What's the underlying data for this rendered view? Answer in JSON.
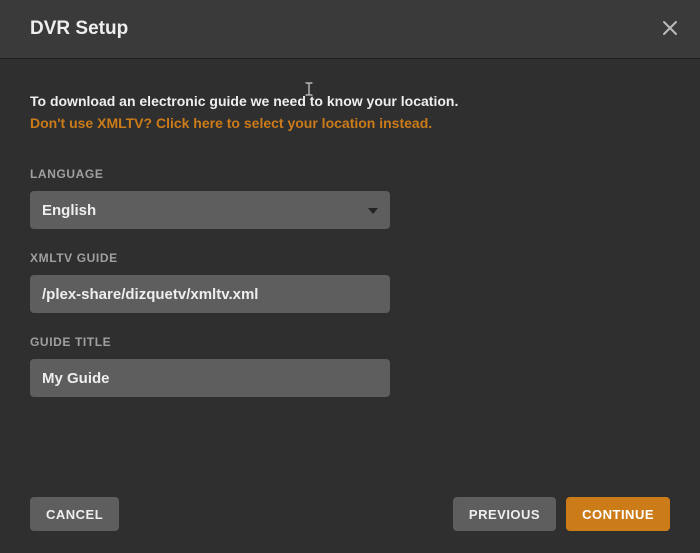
{
  "header": {
    "title": "DVR Setup"
  },
  "intro": {
    "text": "To download an electronic guide we need to know your location.",
    "link": "Don't use XMLTV? Click here to select your location instead."
  },
  "fields": {
    "language": {
      "label": "LANGUAGE",
      "value": "English"
    },
    "xmltv_guide": {
      "label": "XMLTV GUIDE",
      "value": "/plex-share/dizquetv/xmltv.xml"
    },
    "guide_title": {
      "label": "GUIDE TITLE",
      "value": "My Guide"
    }
  },
  "buttons": {
    "cancel": "CANCEL",
    "previous": "PREVIOUS",
    "continue": "CONTINUE"
  }
}
